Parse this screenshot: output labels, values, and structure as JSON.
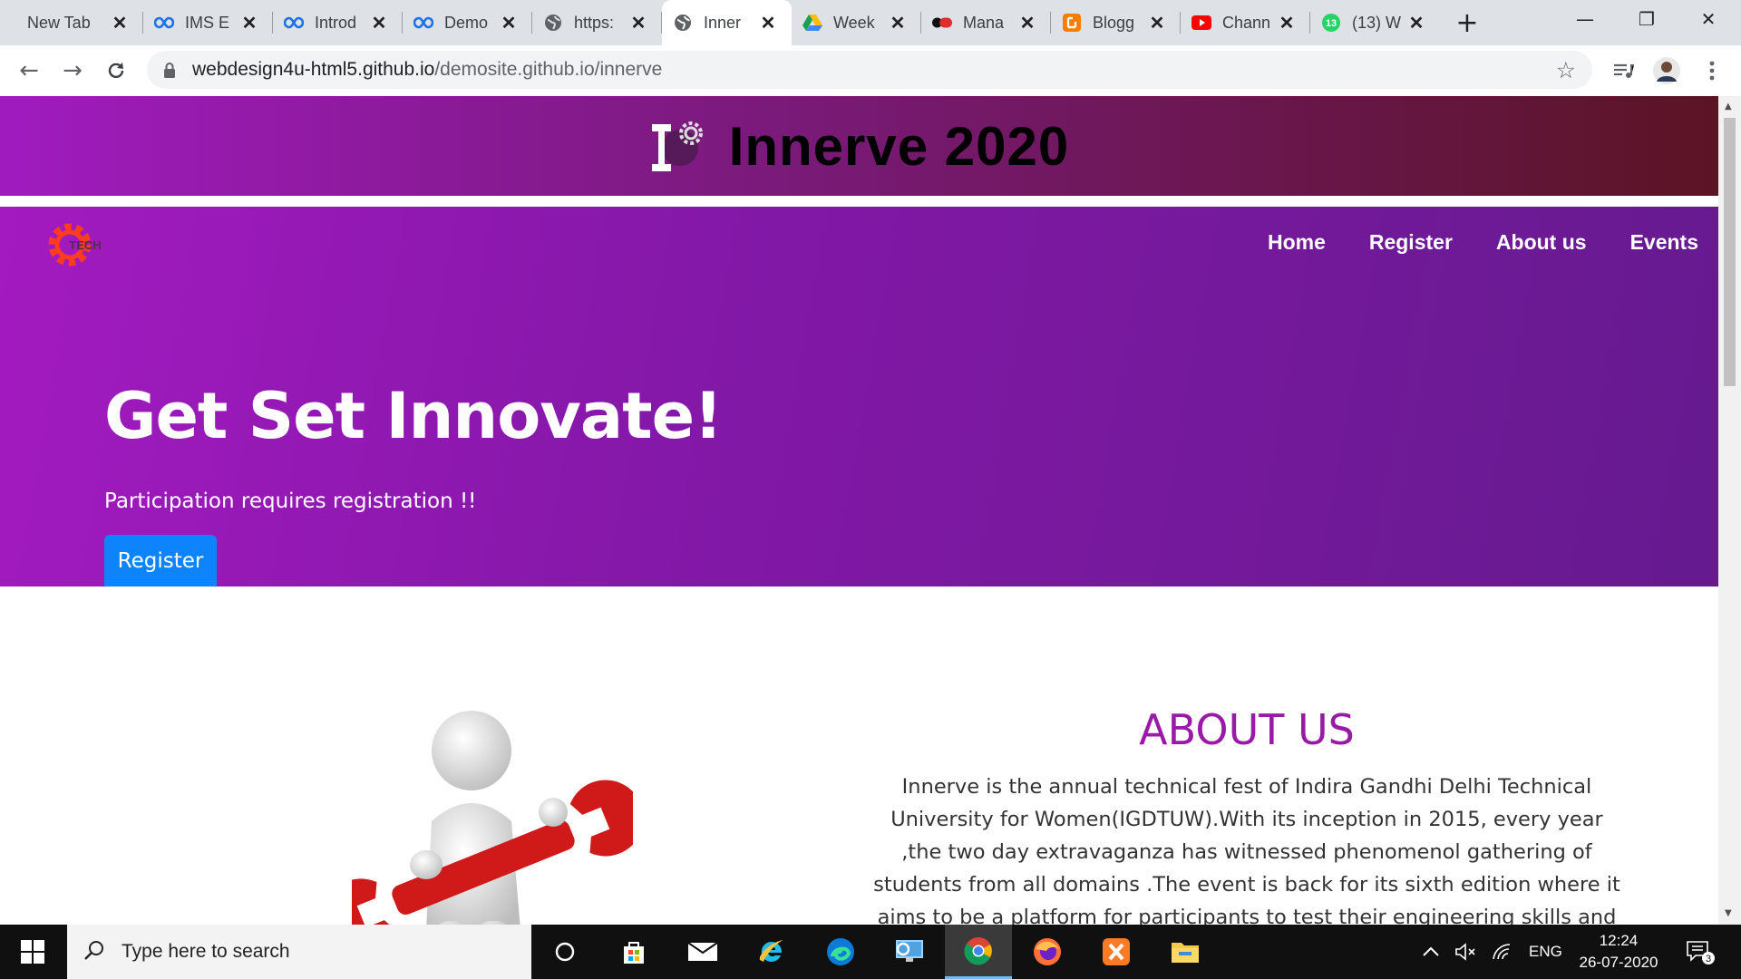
{
  "browser": {
    "tabs": [
      {
        "title": "New Tab",
        "icon": "none"
      },
      {
        "title": "IMS E",
        "icon": "infinity-icon"
      },
      {
        "title": "Introd",
        "icon": "infinity-icon"
      },
      {
        "title": "Demo",
        "icon": "infinity-icon"
      },
      {
        "title": "https:",
        "icon": "globe-icon"
      },
      {
        "title": "Inner",
        "icon": "globe-icon",
        "active": true
      },
      {
        "title": "Week",
        "icon": "drive-icon"
      },
      {
        "title": "Mana",
        "icon": "app-icon"
      },
      {
        "title": "Blogg",
        "icon": "blogger-icon"
      },
      {
        "title": "Chann",
        "icon": "youtube-icon"
      },
      {
        "title": "(13) W",
        "icon": "whatsapp-icon",
        "badge": "13"
      }
    ],
    "url_host": "webdesign4u-html5.github.io",
    "url_path": "/demosite.github.io/innerve"
  },
  "page": {
    "banner_title": "Innerve 2020",
    "brand_text": "TECH",
    "nav": [
      "Home",
      "Register",
      "About us",
      "Events"
    ],
    "hero_title": "Get Set Innovate!",
    "hero_subtitle": "Participation requires registration !!",
    "hero_button": "Register",
    "about_title": "ABOUT US",
    "about_body": "Innerve is the annual technical fest of Indira Gandhi Delhi Technical University for Women(IGDTUW).With its inception in 2015, every year ,the two day extravaganza has witnessed phenomenol gathering of students from all domains .The event is back for its sixth edition where it aims to be a platform for participants to test their engineering skills and showcase their"
  },
  "taskbar": {
    "search_placeholder": "Type here to search",
    "language": "ENG",
    "time": "12:24",
    "date": "26-07-2020",
    "notifications": "3"
  },
  "colors": {
    "hero_start": "#a31ac0",
    "hero_end": "#651a8f",
    "button_blue": "#0d84fb",
    "about_title": "#9a1aa8"
  }
}
